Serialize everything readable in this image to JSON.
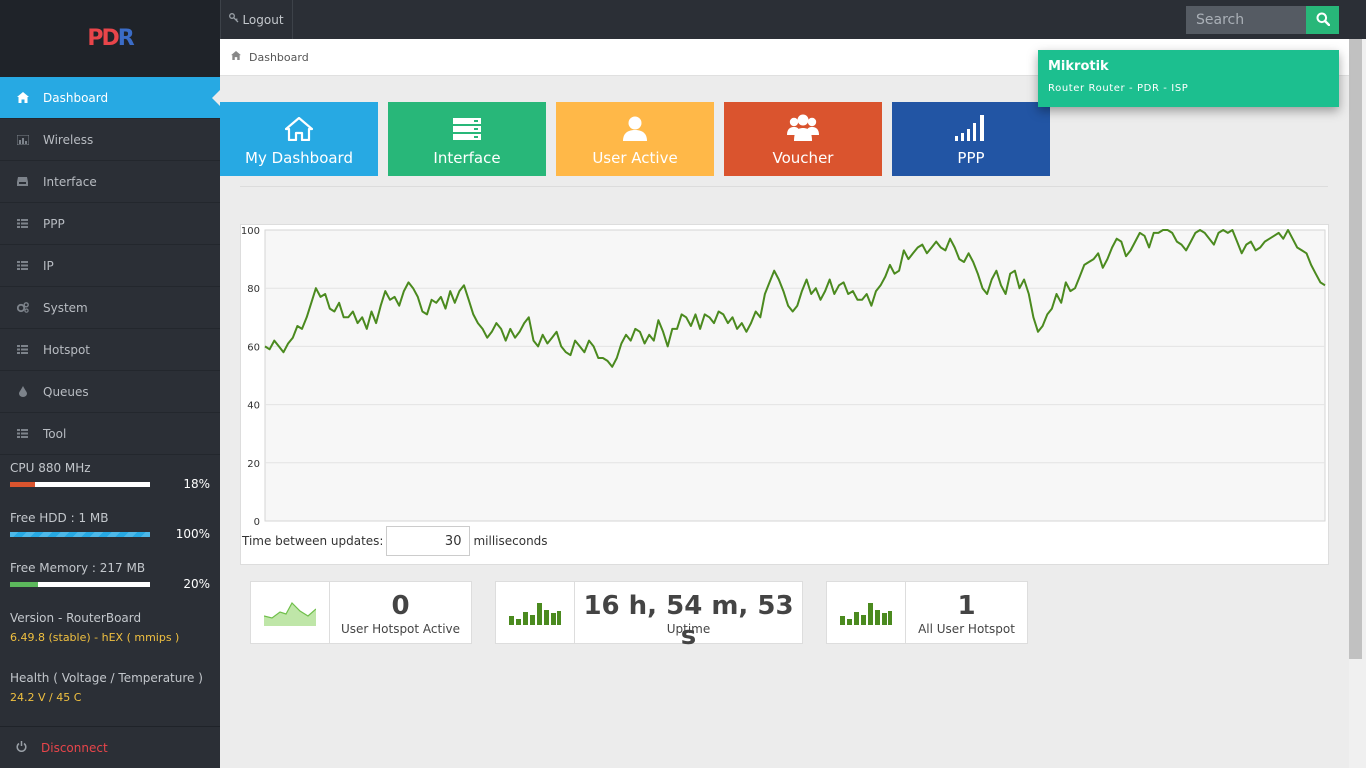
{
  "logo": {
    "text_a": "PD",
    "text_b": "R"
  },
  "sidebar": {
    "items": [
      {
        "label": "Dashboard",
        "icon": "home-icon",
        "active": true
      },
      {
        "label": "Wireless",
        "icon": "bar-chart-icon"
      },
      {
        "label": "Interface",
        "icon": "inbox-icon"
      },
      {
        "label": "PPP",
        "icon": "list-icon"
      },
      {
        "label": "IP",
        "icon": "list-icon"
      },
      {
        "label": "System",
        "icon": "gears-icon"
      },
      {
        "label": "Hotspot",
        "icon": "list-icon"
      },
      {
        "label": "Queues",
        "icon": "tint-icon"
      },
      {
        "label": "Tool",
        "icon": "list-icon"
      }
    ],
    "cpu": {
      "label": "CPU 880 MHz",
      "percent": "18%",
      "fill_fraction": 0.18,
      "color": "#da542e"
    },
    "hdd": {
      "label": "Free HDD : 1 MB",
      "percent": "100%",
      "fill_fraction": 1.0,
      "color": "#27a9e3"
    },
    "memory": {
      "label": "Free Memory : 217 MB",
      "percent": "20%",
      "fill_fraction": 0.2,
      "color": "#5cb85c"
    },
    "version": {
      "label": "Version - RouterBoard",
      "value": "6.49.8 (stable) - hEX ( mmips )"
    },
    "health": {
      "label": "Health ( Voltage / Temperature )",
      "value": "24.2 V / 45 C"
    },
    "disconnect": "Disconnect"
  },
  "topbar": {
    "logout": "Logout",
    "search_placeholder": "Search"
  },
  "breadcrumb": {
    "label": "Dashboard"
  },
  "notification": {
    "title": "Mikrotik",
    "subtitle": "Router Router - PDR - ISP",
    "color": "#1cbf8f"
  },
  "quick_buttons": [
    {
      "label": "My Dashboard",
      "icon": "home-icon",
      "color": "#27a9e3"
    },
    {
      "label": "Interface",
      "icon": "server-icon",
      "color": "#28b779"
    },
    {
      "label": "User Active",
      "icon": "user-icon",
      "color": "#ffb848"
    },
    {
      "label": "Voucher",
      "icon": "users-icon",
      "color": "#da542e"
    },
    {
      "label": "PPP",
      "icon": "signal-icon",
      "color": "#2255a4"
    }
  ],
  "update_control": {
    "label": "Time between updates:",
    "value": "30",
    "unit": "milliseconds"
  },
  "chart_data": {
    "type": "line",
    "ylim": [
      0,
      100
    ],
    "yticks": [
      0,
      20,
      40,
      60,
      80,
      100
    ],
    "color": "#4b8a1f",
    "series": [
      {
        "values": [
          60,
          59,
          62,
          60,
          58,
          61,
          63,
          67,
          66,
          70,
          75,
          80,
          77,
          78,
          73,
          72,
          75,
          70,
          70,
          72,
          68,
          70,
          66,
          72,
          68,
          74,
          79,
          76,
          77,
          74,
          79,
          82,
          80,
          77,
          72,
          71,
          76,
          75,
          77,
          73,
          79,
          75,
          79,
          81,
          76,
          71,
          68,
          66,
          63,
          65,
          68,
          66,
          62,
          66,
          63,
          65,
          68,
          70,
          62,
          60,
          64,
          61,
          63,
          65,
          60,
          58,
          57,
          62,
          60,
          58,
          62,
          60,
          56,
          56,
          55,
          53,
          56,
          61,
          64,
          62,
          66,
          65,
          61,
          64,
          62,
          69,
          65,
          60,
          66,
          66,
          71,
          70,
          67,
          71,
          66,
          71,
          70,
          68,
          72,
          71,
          68,
          70,
          66,
          68,
          65,
          68,
          72,
          70,
          78,
          82,
          86,
          83,
          79,
          74,
          72,
          74,
          79,
          83,
          78,
          80,
          76,
          79,
          83,
          78,
          81,
          82,
          78,
          79,
          76,
          76,
          78,
          74,
          79,
          81,
          84,
          88,
          85,
          86,
          93,
          90,
          92,
          94,
          95,
          92,
          94,
          96,
          94,
          93,
          97,
          94,
          90,
          89,
          92,
          89,
          85,
          80,
          78,
          83,
          86,
          81,
          78,
          85,
          86,
          80,
          83,
          78,
          70,
          65,
          67,
          71,
          73,
          78,
          75,
          82,
          79,
          80,
          84,
          88,
          89,
          90,
          92,
          87,
          90,
          94,
          97,
          96,
          91,
          93,
          96,
          99,
          98,
          94,
          99,
          99,
          100,
          100,
          99,
          96,
          95,
          93,
          96,
          99,
          100,
          99,
          97,
          95,
          99,
          100,
          99,
          100,
          96,
          92,
          95,
          96,
          93,
          94,
          96,
          97,
          98,
          99,
          97,
          100,
          97,
          94,
          93,
          92,
          88,
          85,
          82,
          81
        ]
      }
    ]
  },
  "stat_boxes": [
    {
      "value": "0",
      "label": "User Hotspot Active",
      "icon": "area-chart-icon"
    },
    {
      "value": "16 h, 54 m, 53 s",
      "label": "Uptime",
      "icon": "bar-chart-icon"
    },
    {
      "value": "1",
      "label": "All User Hotspot",
      "icon": "bar-chart-icon"
    }
  ]
}
